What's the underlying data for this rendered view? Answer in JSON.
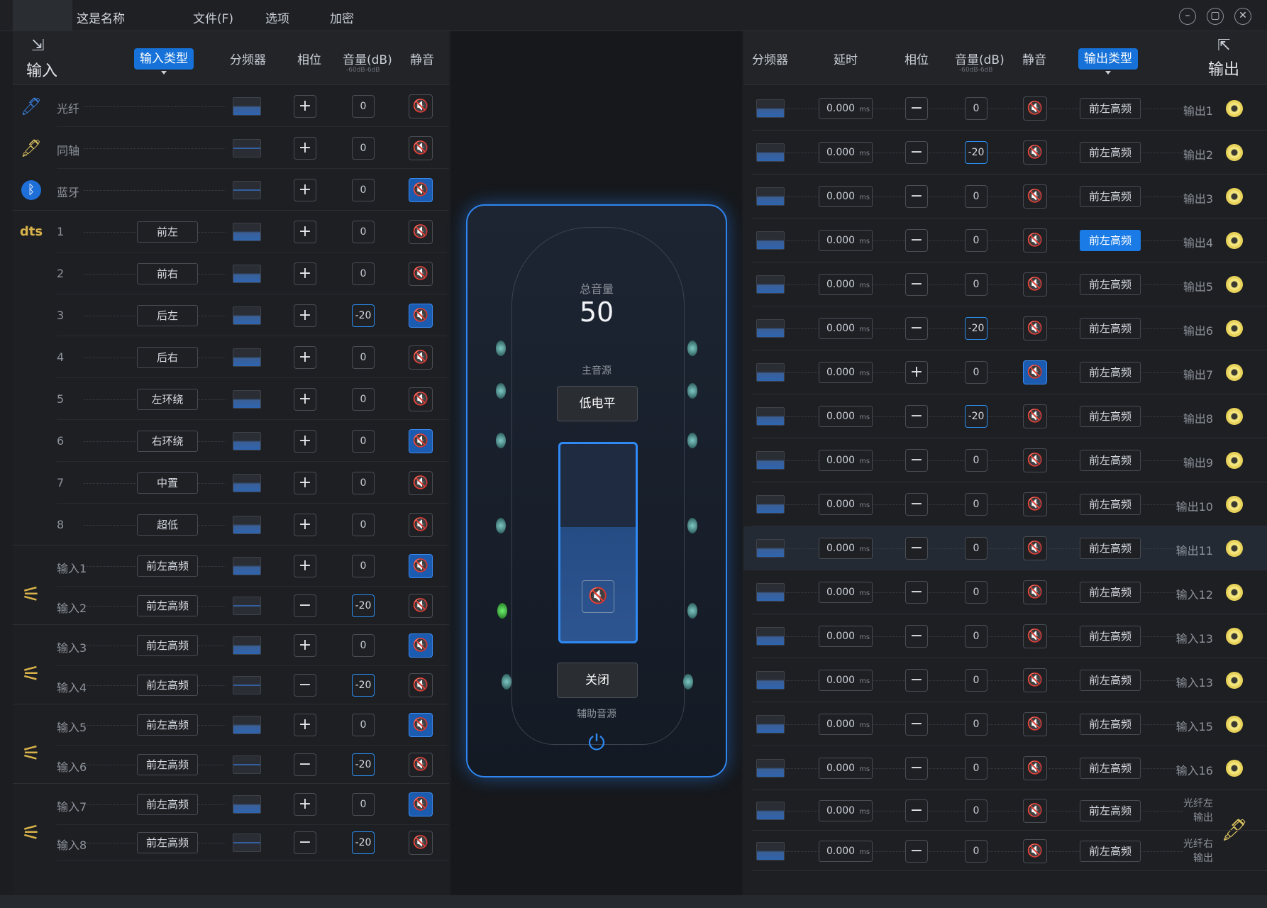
{
  "app": {
    "name": "这是名称",
    "menus": [
      "文件(F)",
      "选项",
      "加密"
    ]
  },
  "colors": {
    "accent": "#1a7be6",
    "background": "#1b1d21",
    "highlight": "#2f8af5"
  },
  "left": {
    "title": "输入",
    "title_icon": "import-icon",
    "headers": {
      "type": "输入类型",
      "xover": "分频器",
      "phase": "相位",
      "vol": "音量(dB)",
      "vol_range": "-60dB-6dB",
      "mute": "静音"
    },
    "rows": [
      {
        "icon": "fiber-cable-icon",
        "label": "光纤",
        "type": "",
        "flat": false,
        "phase": "+",
        "vol": "0",
        "mute": false
      },
      {
        "icon": "coax-cable-icon",
        "label": "同轴",
        "type": "",
        "flat": true,
        "phase": "+",
        "vol": "0",
        "mute": false
      },
      {
        "icon": "bluetooth-icon",
        "label": "蓝牙",
        "type": "",
        "flat": true,
        "phase": "+",
        "vol": "0",
        "mute": true
      },
      {
        "icon": "dts-icon",
        "label": "1",
        "type": "前左",
        "flat": false,
        "phase": "+",
        "vol": "0",
        "mute": false
      },
      {
        "label": "2",
        "type": "前右",
        "flat": false,
        "phase": "+",
        "vol": "0",
        "mute": false
      },
      {
        "label": "3",
        "type": "后左",
        "flat": false,
        "phase": "+",
        "vol": "-20",
        "mute": true
      },
      {
        "label": "4",
        "type": "后右",
        "flat": false,
        "phase": "+",
        "vol": "0",
        "mute": false
      },
      {
        "label": "5",
        "type": "左环绕",
        "flat": false,
        "phase": "+",
        "vol": "0",
        "mute": false
      },
      {
        "label": "6",
        "type": "右环绕",
        "flat": false,
        "phase": "+",
        "vol": "0",
        "mute": true
      },
      {
        "label": "7",
        "type": "中置",
        "flat": false,
        "phase": "+",
        "vol": "0",
        "mute": false
      },
      {
        "label": "8",
        "type": "超低",
        "flat": false,
        "phase": "+",
        "vol": "0",
        "mute": false
      },
      {
        "label": "输入1",
        "type": "前左高频",
        "flat": false,
        "phase": "+",
        "vol": "0",
        "mute": true
      },
      {
        "label": "输入2",
        "type": "前左高频",
        "flat": true,
        "phase": "−",
        "vol": "-20",
        "mute": false
      },
      {
        "label": "输入3",
        "type": "前左高频",
        "flat": false,
        "phase": "+",
        "vol": "0",
        "mute": true
      },
      {
        "label": "输入4",
        "type": "前左高频",
        "flat": true,
        "phase": "−",
        "vol": "-20",
        "mute": false
      },
      {
        "label": "输入5",
        "type": "前左高频",
        "flat": false,
        "phase": "+",
        "vol": "0",
        "mute": true
      },
      {
        "label": "输入6",
        "type": "前左高频",
        "flat": true,
        "phase": "−",
        "vol": "-20",
        "mute": false
      },
      {
        "label": "输入7",
        "type": "前左高频",
        "flat": false,
        "phase": "+",
        "vol": "0",
        "mute": true
      },
      {
        "label": "输入8",
        "type": "前左高频",
        "flat": true,
        "phase": "−",
        "vol": "-20",
        "mute": false
      }
    ]
  },
  "center": {
    "master_label": "总音量",
    "master_value": "50",
    "main_source_label": "主音源",
    "main_source": "低电平",
    "aux_button": "关闭",
    "aux_label": "辅助音源",
    "mute_icon": "mute-icon",
    "power_icon": "power-icon"
  },
  "right": {
    "title": "输出",
    "title_icon": "export-icon",
    "headers": {
      "xover": "分频器",
      "delay": "延时",
      "phase": "相位",
      "vol": "音量(dB)",
      "vol_range": "-60dB-6dB",
      "mute": "静音",
      "type": "输出类型"
    },
    "rows": [
      {
        "delay": "0.000",
        "unit": "ms",
        "phase": "−",
        "vol": "0",
        "mute": false,
        "type": "前左高频",
        "active": false,
        "name": "输出1"
      },
      {
        "delay": "0.000",
        "unit": "ms",
        "phase": "−",
        "vol": "-20",
        "mute": false,
        "type": "前左高频",
        "active": false,
        "name": "输出2"
      },
      {
        "delay": "0.000",
        "unit": "ms",
        "phase": "−",
        "vol": "0",
        "mute": false,
        "type": "前左高频",
        "active": false,
        "name": "输出3"
      },
      {
        "delay": "0.000",
        "unit": "ms",
        "phase": "−",
        "vol": "0",
        "mute": false,
        "type": "前左高频",
        "active": true,
        "name": "输出4"
      },
      {
        "delay": "0.000",
        "unit": "ms",
        "phase": "−",
        "vol": "0",
        "mute": false,
        "type": "前左高频",
        "active": false,
        "name": "输出5"
      },
      {
        "delay": "0.000",
        "unit": "ms",
        "phase": "−",
        "vol": "-20",
        "mute": false,
        "type": "前左高频",
        "active": false,
        "name": "输出6"
      },
      {
        "delay": "0.000",
        "unit": "ms",
        "phase": "+",
        "vol": "0",
        "mute": true,
        "type": "前左高频",
        "active": false,
        "name": "输出7"
      },
      {
        "delay": "0.000",
        "unit": "ms",
        "phase": "−",
        "vol": "-20",
        "mute": false,
        "type": "前左高频",
        "active": false,
        "name": "输出8"
      },
      {
        "delay": "0.000",
        "unit": "ms",
        "phase": "−",
        "vol": "0",
        "mute": false,
        "type": "前左高频",
        "active": false,
        "name": "输出9"
      },
      {
        "delay": "0.000",
        "unit": "ms",
        "phase": "−",
        "vol": "0",
        "mute": false,
        "type": "前左高频",
        "active": false,
        "name": "输出10"
      },
      {
        "delay": "0.000",
        "unit": "ms",
        "phase": "−",
        "vol": "0",
        "mute": false,
        "type": "前左高频",
        "active": false,
        "name": "输出11"
      },
      {
        "delay": "0.000",
        "unit": "ms",
        "phase": "−",
        "vol": "0",
        "mute": false,
        "type": "前左高频",
        "active": false,
        "name": "输入12"
      },
      {
        "delay": "0.000",
        "unit": "ms",
        "phase": "−",
        "vol": "0",
        "mute": false,
        "type": "前左高频",
        "active": false,
        "name": "输入13"
      },
      {
        "delay": "0.000",
        "unit": "ms",
        "phase": "−",
        "vol": "0",
        "mute": false,
        "type": "前左高频",
        "active": false,
        "name": "输入13"
      },
      {
        "delay": "0.000",
        "unit": "ms",
        "phase": "−",
        "vol": "0",
        "mute": false,
        "type": "前左高频",
        "active": false,
        "name": "输入15"
      },
      {
        "delay": "0.000",
        "unit": "ms",
        "phase": "−",
        "vol": "0",
        "mute": false,
        "type": "前左高频",
        "active": false,
        "name": "输入16"
      },
      {
        "delay": "0.000",
        "unit": "ms",
        "phase": "−",
        "vol": "0",
        "mute": false,
        "type": "前左高频",
        "active": false,
        "name": "光纤左输出",
        "name_lines": [
          "光纤左",
          "输出"
        ]
      },
      {
        "delay": "0.000",
        "unit": "ms",
        "phase": "−",
        "vol": "0",
        "mute": false,
        "type": "前左高频",
        "active": false,
        "name": "光纤右输出",
        "name_lines": [
          "光纤右",
          "输出"
        ]
      }
    ]
  }
}
